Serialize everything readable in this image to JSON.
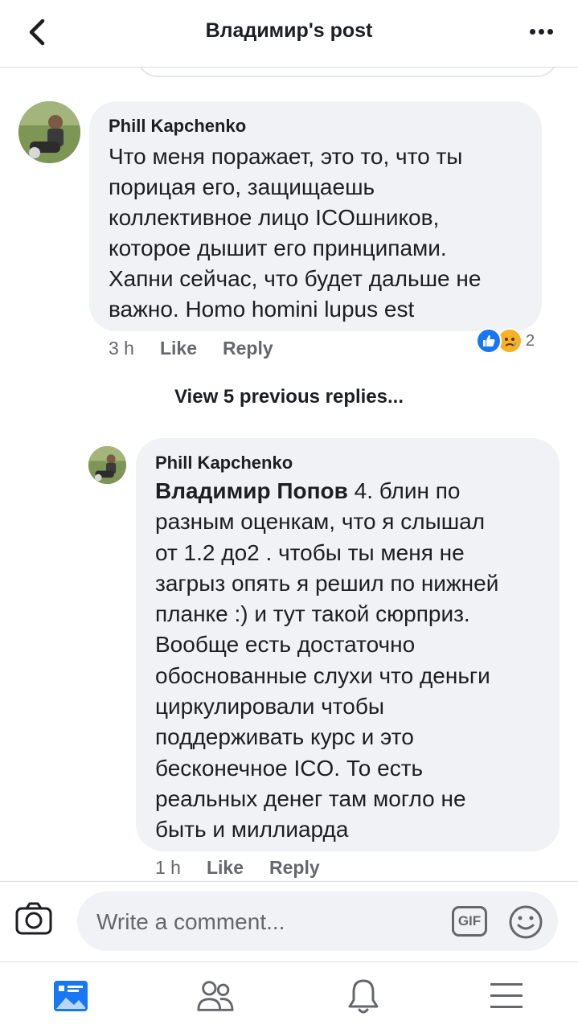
{
  "header": {
    "title": "Владимир's post",
    "back_icon": "chevron-left-icon",
    "more_icon": "more-dots-icon"
  },
  "comments": [
    {
      "author": "Phill Kapchenko",
      "text_lines": [
        "Что меня поражает, это то, что ты",
        "порицая его, защищаешь",
        "коллективное лицо ICOшников,",
        "которое дышит его принципами.",
        "Хапни сейчас, что будет дальше не",
        "важно. Homo homini lupus est"
      ],
      "time": "3 h",
      "like": "Like",
      "reply": "Reply",
      "reactions": {
        "types": [
          "like",
          "sad"
        ],
        "count": "2"
      }
    }
  ],
  "view_previous": "View 5 previous replies...",
  "reply": {
    "author": "Phill Kapchenko",
    "mention": "Владимир Попов",
    "text_lines": [
      " 4. блин по",
      "разным оценкам, что я слышал",
      "от 1.2 до2 . чтобы ты меня не",
      "загрыз опять я решил по нижней",
      "планке :) и тут такой сюрприз.",
      "Вообще есть достаточно",
      "обоснованные слухи что деньги",
      "циркулировали чтобы",
      "поддерживать курс и это",
      "бесконечное ICO. То есть",
      "реальных денег там могло не",
      "быть и миллиарда"
    ],
    "time": "1 h",
    "like": "Like",
    "reply": "Reply"
  },
  "composer": {
    "placeholder": "Write a comment...",
    "gif_label": "GIF",
    "camera_icon": "camera-icon",
    "emoji_icon": "smiley-icon"
  },
  "tabbar": {
    "items": [
      "news-feed-icon",
      "friends-icon",
      "notifications-bell-icon",
      "menu-icon"
    ],
    "active_color": "#1877f2"
  }
}
